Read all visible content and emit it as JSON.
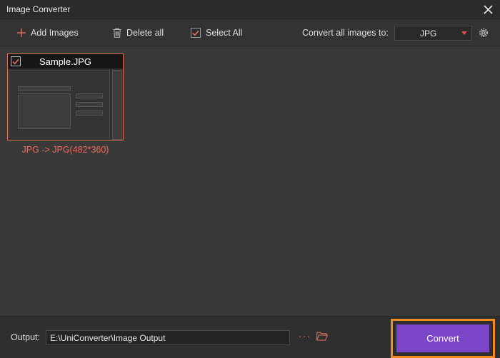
{
  "window": {
    "title": "Image Converter"
  },
  "toolbar": {
    "add_images": "Add Images",
    "delete_all": "Delete all",
    "select_all": "Select All",
    "select_all_checked": true,
    "convert_all_label": "Convert all images to:",
    "format": "JPG"
  },
  "files": [
    {
      "name": "Sample.JPG",
      "checked": true,
      "conversion": "JPG -> JPG(482*360)"
    }
  ],
  "bottom": {
    "output_label": "Output:",
    "output_path": "E:\\UniConverter\\Image Output",
    "more": "···",
    "convert_label": "Convert"
  },
  "colors": {
    "accent": "#e86a5d",
    "convert": "#7a45c6",
    "highlight": "#f28a23"
  }
}
